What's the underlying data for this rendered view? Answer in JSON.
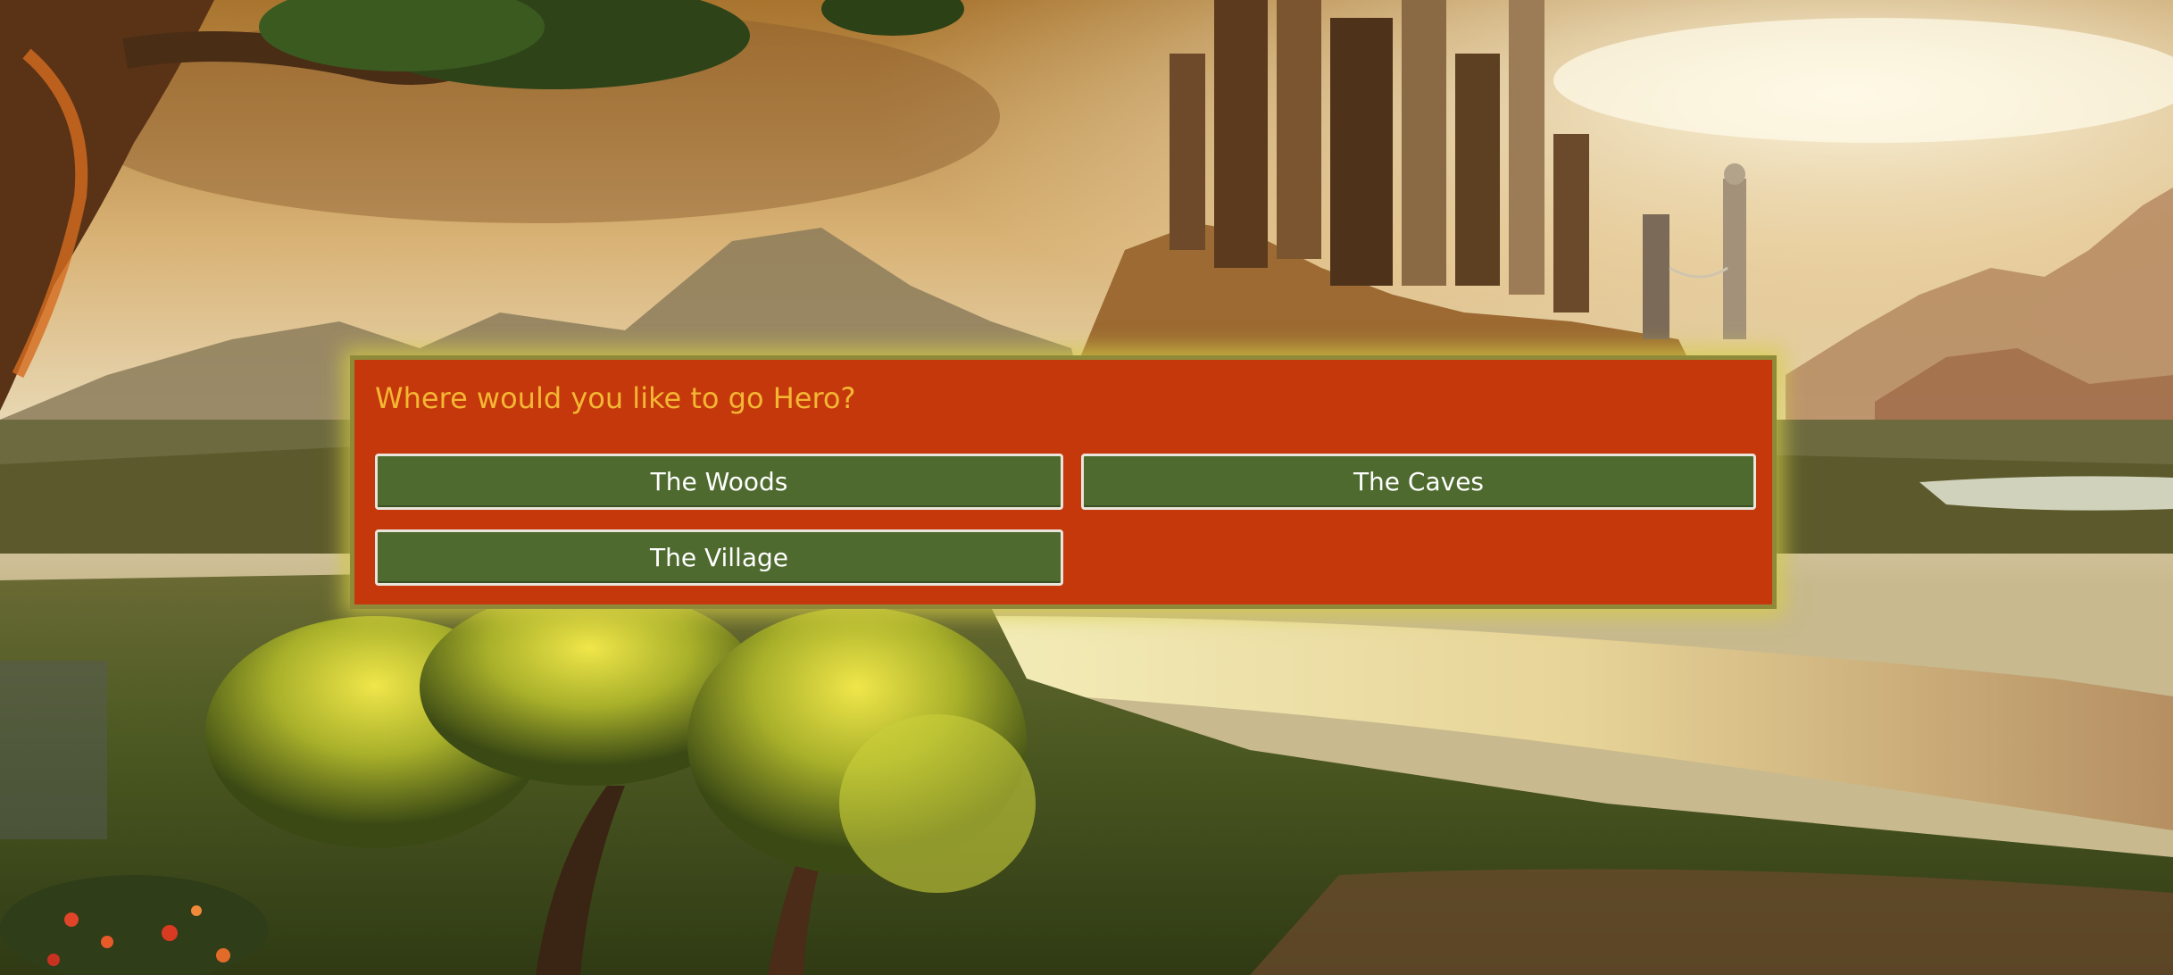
{
  "scene": {
    "description_icon": "fantasy-landscape-castle"
  },
  "dialog": {
    "prompt": "Where would you like to go Hero?",
    "choices": [
      {
        "label": "The Woods"
      },
      {
        "label": "The Caves"
      },
      {
        "label": "The Village"
      }
    ]
  },
  "colors": {
    "dialog_background": "#c5380c",
    "dialog_border": "#8f8a3a",
    "prompt_text": "#f4b733",
    "button_background": "#4e6a2e",
    "button_border": "#e9e5dc",
    "button_text": "#ffffff"
  }
}
